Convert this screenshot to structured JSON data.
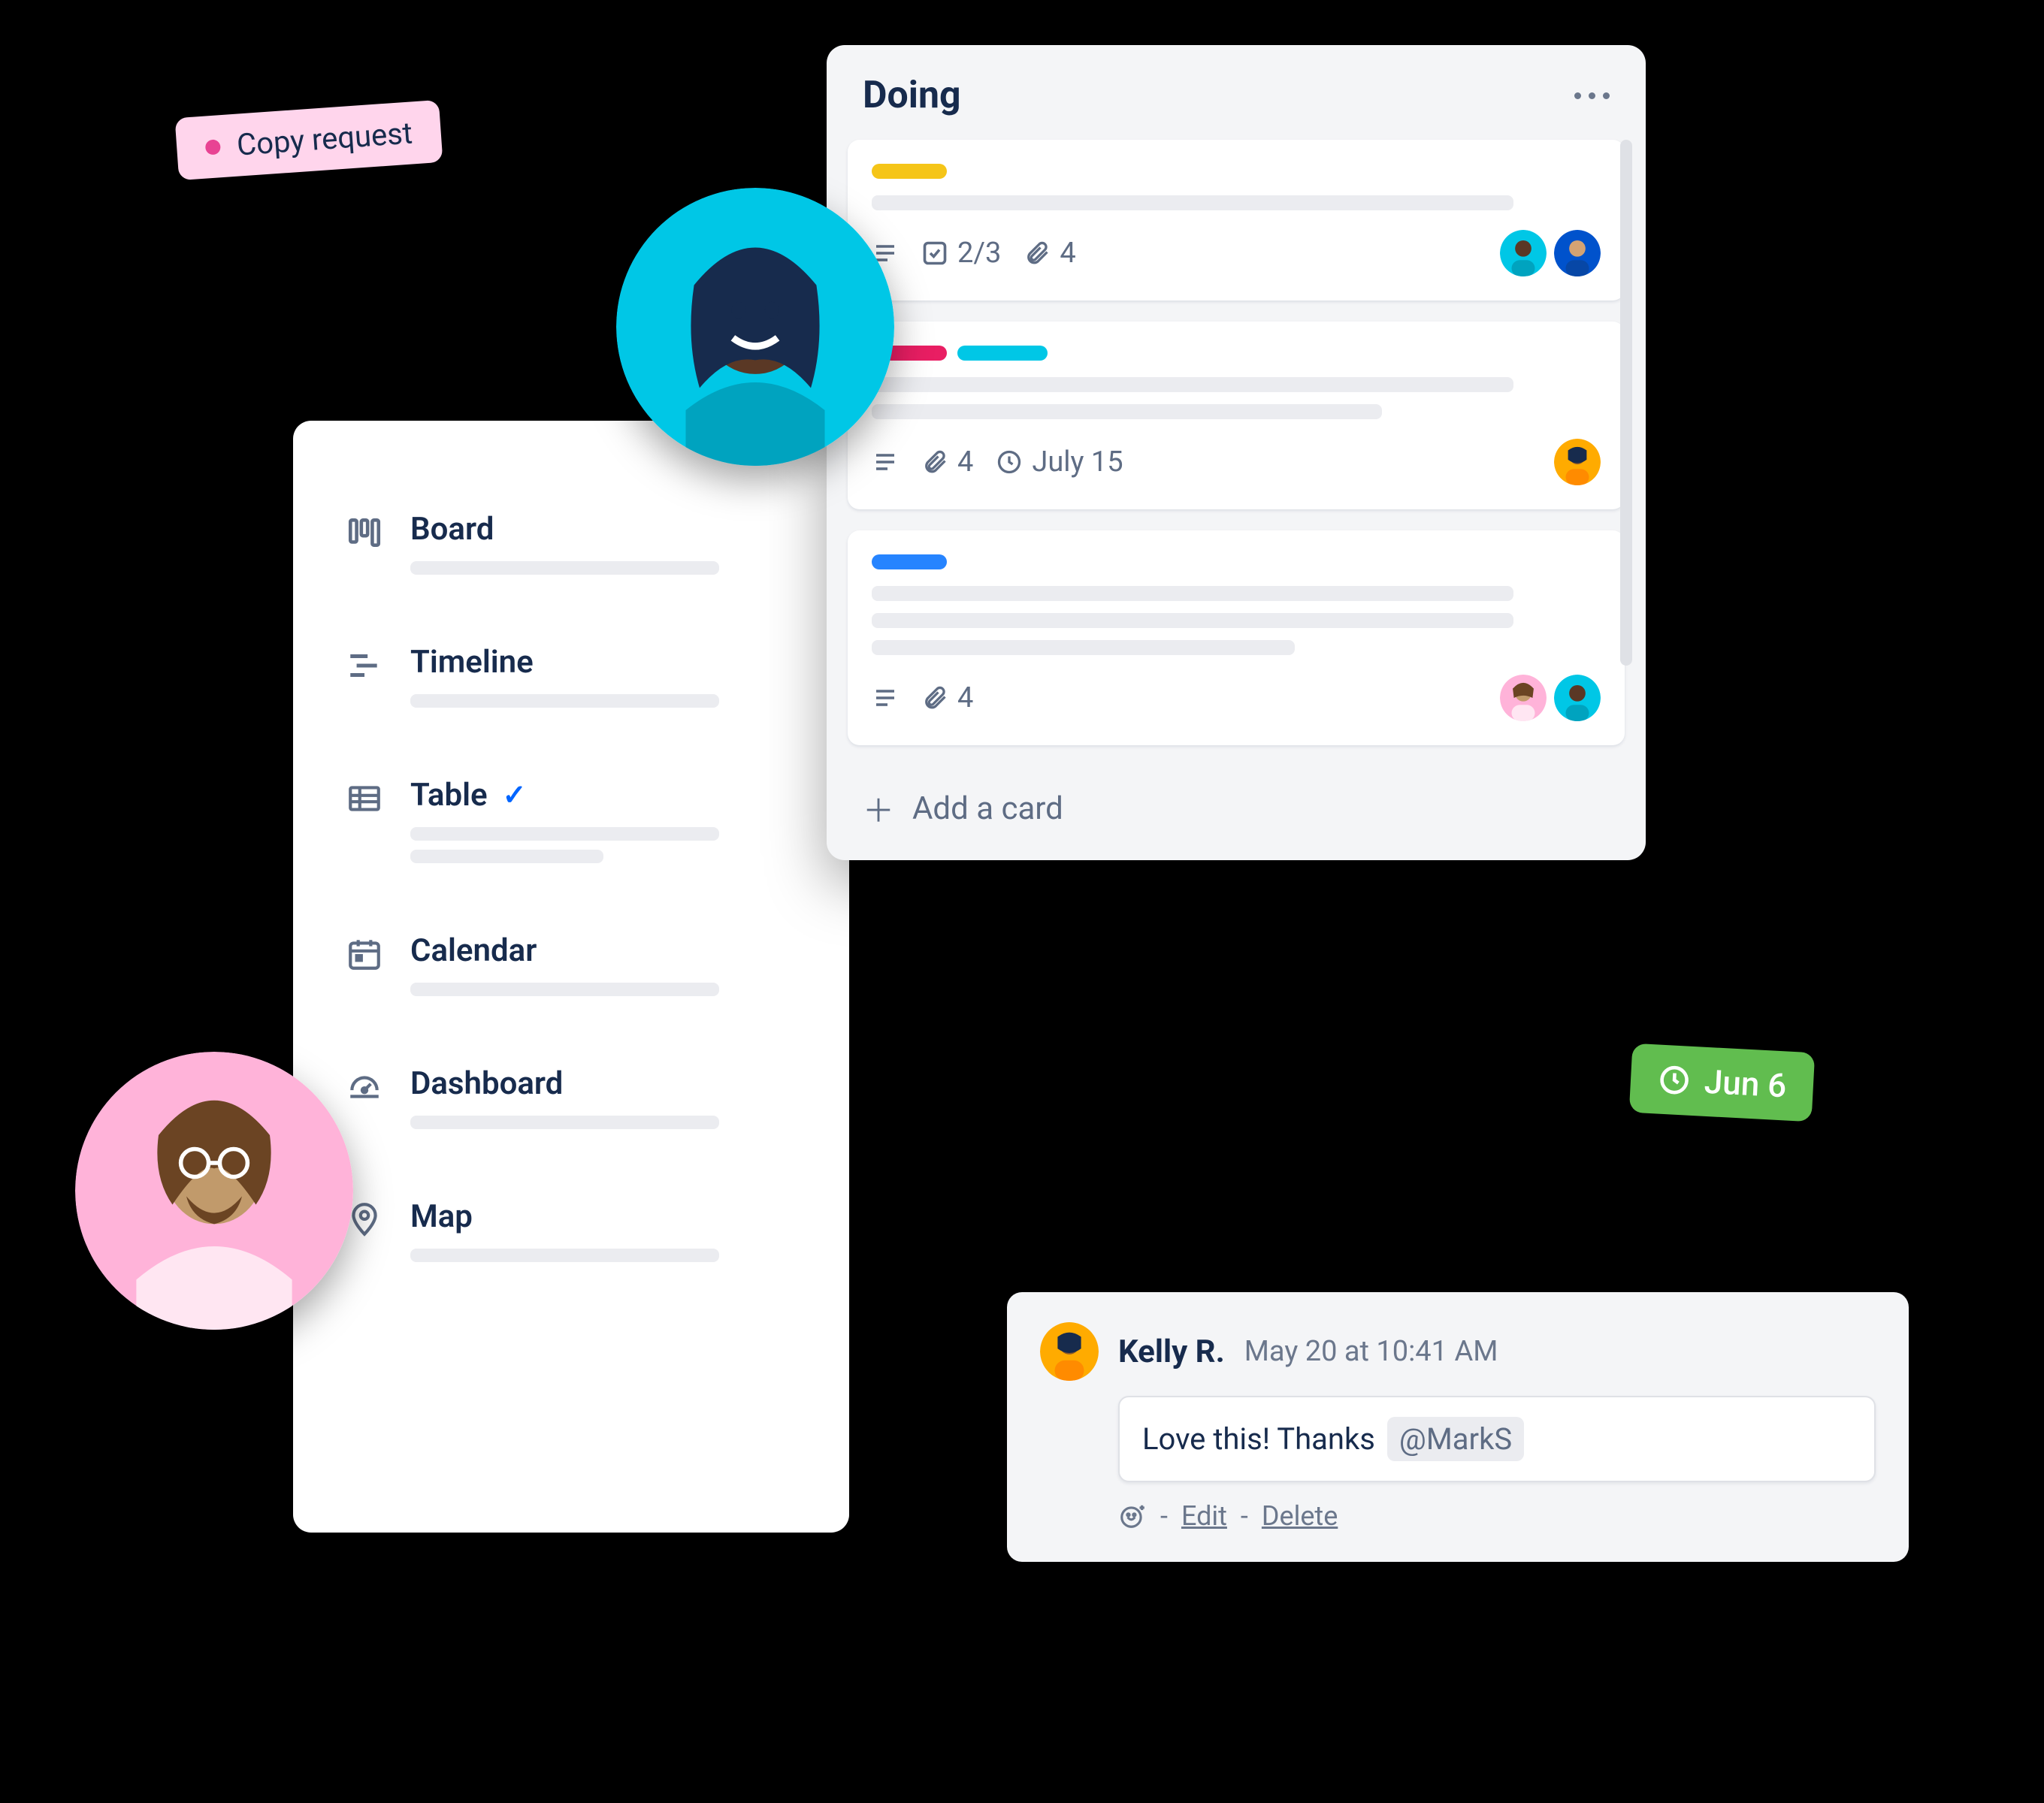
{
  "tag": {
    "label": "Copy request"
  },
  "views": {
    "items": [
      {
        "label": "Board",
        "icon": "board-icon"
      },
      {
        "label": "Timeline",
        "icon": "timeline-icon"
      },
      {
        "label": "Table",
        "icon": "table-icon",
        "selected": true
      },
      {
        "label": "Calendar",
        "icon": "calendar-icon"
      },
      {
        "label": "Dashboard",
        "icon": "dashboard-icon"
      },
      {
        "label": "Map",
        "icon": "map-icon"
      }
    ]
  },
  "list": {
    "title": "Doing",
    "add_card": "Add a card",
    "cards": [
      {
        "labels": [
          "yellow"
        ],
        "checklist": "2/3",
        "attachments": "4",
        "members": [
          "teal",
          "blue"
        ]
      },
      {
        "labels": [
          "pink",
          "teal"
        ],
        "attachments": "4",
        "due": "July 15",
        "members": [
          "orange"
        ]
      },
      {
        "labels": [
          "blue"
        ],
        "attachments": "4",
        "members": [
          "pink",
          "teal"
        ]
      }
    ]
  },
  "date_badge": {
    "label": "Jun 6"
  },
  "comment": {
    "author": "Kelly R.",
    "timestamp": "May 20 at 10:41 AM",
    "text": "Love this! Thanks",
    "mention": "@MarkS",
    "actions": {
      "edit": "Edit",
      "delete": "Delete"
    }
  }
}
